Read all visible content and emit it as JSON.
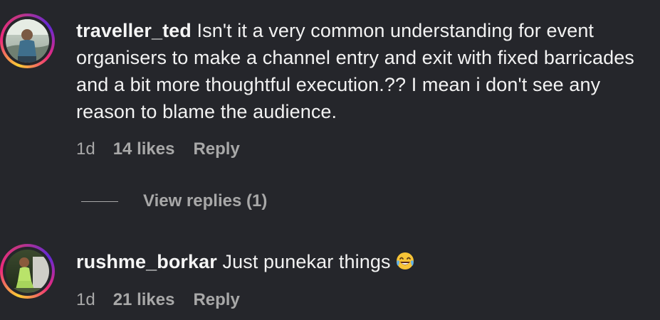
{
  "comments": [
    {
      "username": "traveller_ted",
      "text": "Isn't it a very common understanding for event organisers to make a channel entry and exit with fixed barricades and a bit more thoughtful execution.?? I mean i don't see any reason to blame the audience.",
      "time": "1d",
      "likes": "14 likes",
      "reply_label": "Reply",
      "view_replies": "View replies (1)"
    },
    {
      "username": "rushme_borkar",
      "text": "Just punekar things",
      "emoji": "face-with-tears-of-joy-icon",
      "time": "1d",
      "likes": "21 likes",
      "reply_label": "Reply"
    }
  ],
  "colors": {
    "background": "#25262b",
    "primary_text": "#f2f2f2",
    "secondary_text": "#a8a8a8",
    "story_ring_start": "#f9ce34",
    "story_ring_mid": "#ee2a7b",
    "story_ring_end": "#6228d7"
  }
}
